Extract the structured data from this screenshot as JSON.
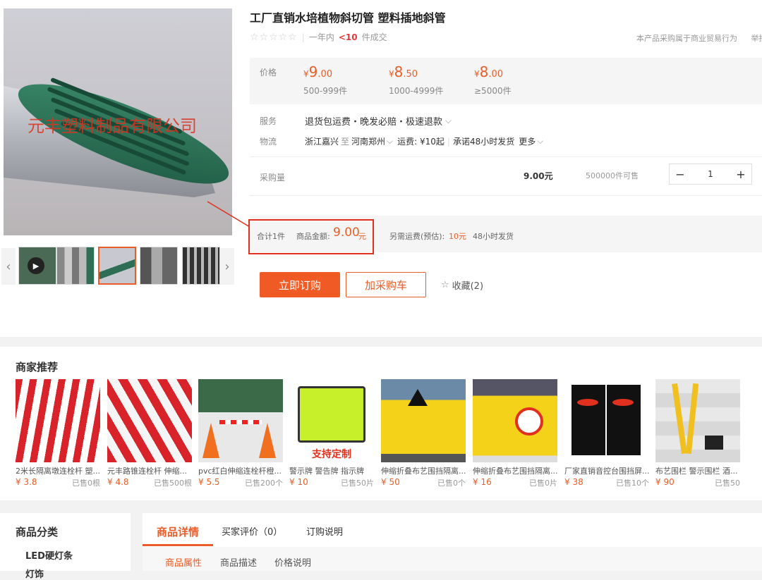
{
  "product": {
    "title": "工厂直销水培植物斜切管 塑料插地斜管",
    "rating_stars": "☆☆☆☆☆",
    "sales_prefix": "一年内",
    "sales_count": "<10",
    "sales_suffix": "件成交",
    "notice": "本产品采购属于商业贸易行为",
    "report": "举报",
    "watermark": "元丰塑料制品有限公司"
  },
  "price": {
    "label": "价格",
    "tiers": [
      {
        "currency": "¥",
        "int": "9",
        "dec": ".00",
        "range": "500-999件"
      },
      {
        "currency": "¥",
        "int": "8",
        "dec": ".50",
        "range": "1000-4999件"
      },
      {
        "currency": "¥",
        "int": "8",
        "dec": ".00",
        "range": "≥5000件"
      }
    ]
  },
  "service": {
    "label": "服务",
    "value": "退货包运费・晚发必赔・极速退款",
    "chevron": "⌵"
  },
  "logistics": {
    "label": "物流",
    "from": "浙江嘉兴",
    "to_word": "至",
    "to": "河南郑州",
    "fee": "运费: ¥10起",
    "promise": "承诺48小时发货",
    "more": "更多"
  },
  "purchase": {
    "label": "采购量",
    "unit_price": "9.00元",
    "stock": "500000件可售",
    "qty": "1",
    "minus": "−",
    "plus": "+"
  },
  "total": {
    "count": "合计1件",
    "amount_label": "商品金额:",
    "amount": "9.00",
    "amount_unit": "元",
    "freight": "另需运费(预估):",
    "freight_val": "10元",
    "ship": "48小时发货"
  },
  "buttons": {
    "buy": "立即订购",
    "cart": "加采购车",
    "fav": "收藏(2)"
  },
  "recommend": {
    "title": "商家推荐",
    "items": [
      {
        "name": "2米长隔离墩连栓杆 塑...",
        "price": "¥ 3.8",
        "sold": "已售0根"
      },
      {
        "name": "元丰路锥连栓杆 伸缩...",
        "price": "¥ 4.8",
        "sold": "已售500根"
      },
      {
        "name": "pvc红白伸缩连栓杆橙...",
        "price": "¥ 5.5",
        "sold": "已售200个"
      },
      {
        "name": "警示牌 警告牌 指示牌",
        "price": "¥ 10",
        "sold": "已售50片"
      },
      {
        "name": "伸缩折叠布艺围挡隔离...",
        "price": "¥ 50",
        "sold": "已售0个"
      },
      {
        "name": "伸缩折叠布艺围挡隔离...",
        "price": "¥ 16",
        "sold": "已售0片"
      },
      {
        "name": "厂家直销音控台围挡屏...",
        "price": "¥ 38",
        "sold": "已售10个"
      },
      {
        "name": "布艺围栏 警示围栏 酒...",
        "price": "¥ 90",
        "sold": "已售50"
      }
    ],
    "banner_text": "支持定制"
  },
  "category": {
    "title": "商品分类",
    "item1": "LED硬灯条",
    "item2": "灯饰"
  },
  "tabs": {
    "t1": "商品详情",
    "t2": "买家评价（0）",
    "t3": "订购说明",
    "s1": "商品属性",
    "s2": "商品描述",
    "s3": "价格说明"
  },
  "colors": {
    "accent": "#e85d28",
    "highlight": "#e0301e"
  }
}
